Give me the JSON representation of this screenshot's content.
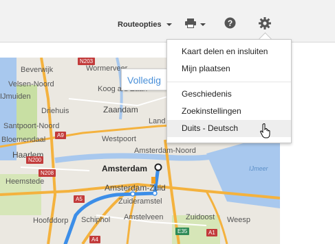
{
  "toolbar": {
    "route_options_label": "Routeopties",
    "icons": [
      "printer-icon",
      "help-icon",
      "gear-icon"
    ]
  },
  "map": {
    "fullscreen_label": "Volledig",
    "places": {
      "beverwijk": "Beverwijk",
      "wormerveer": "Wormerveer",
      "velsen_noord": "Velsen-Noord",
      "koog": "Koog a/d Zaan",
      "ijmuiden": "IJmuiden",
      "zaandam": "Zaandam",
      "driehuis": "Driehuis",
      "landsmeer": "Land",
      "santpoort": "Santpoort-Noord",
      "bloemendaal": "Bloemendaal",
      "westpoort": "Westpoort",
      "amsterdam_noord": "Amsterdam-Noord",
      "haarlem": "Haarlem",
      "amsterdam": "Amsterdam",
      "ijmeer": "IJmeer",
      "heemstede": "Heemstede",
      "amsterdam_zuid": "Amsterdam-Zuid",
      "zuideramstel": "Zuideramstel",
      "hoofddorp": "Hoofddorp",
      "schiphol": "Schiphol",
      "amstelveen": "Amstelveen",
      "zuidoost": "Zuidoost",
      "weesp": "Weesp"
    },
    "road_signs": {
      "n203": "N203",
      "a9": "A9",
      "n200": "N200",
      "n208": "N208",
      "a5": "A5",
      "a4": "A4",
      "e35": "E35",
      "a1": "A1"
    }
  },
  "settings_menu": {
    "items": [
      {
        "label": "Kaart delen en insluiten"
      },
      {
        "label": "Mijn plaatsen"
      },
      {
        "label": "Geschiedenis"
      },
      {
        "label": "Zoekinstellingen"
      },
      {
        "label": "Duits - Deutsch",
        "hovered": true
      }
    ]
  },
  "colors": {
    "route": "#3c8ee8",
    "highway": "#f4b23e",
    "water": "#a8c8ee",
    "green": "#c8dfa3"
  }
}
